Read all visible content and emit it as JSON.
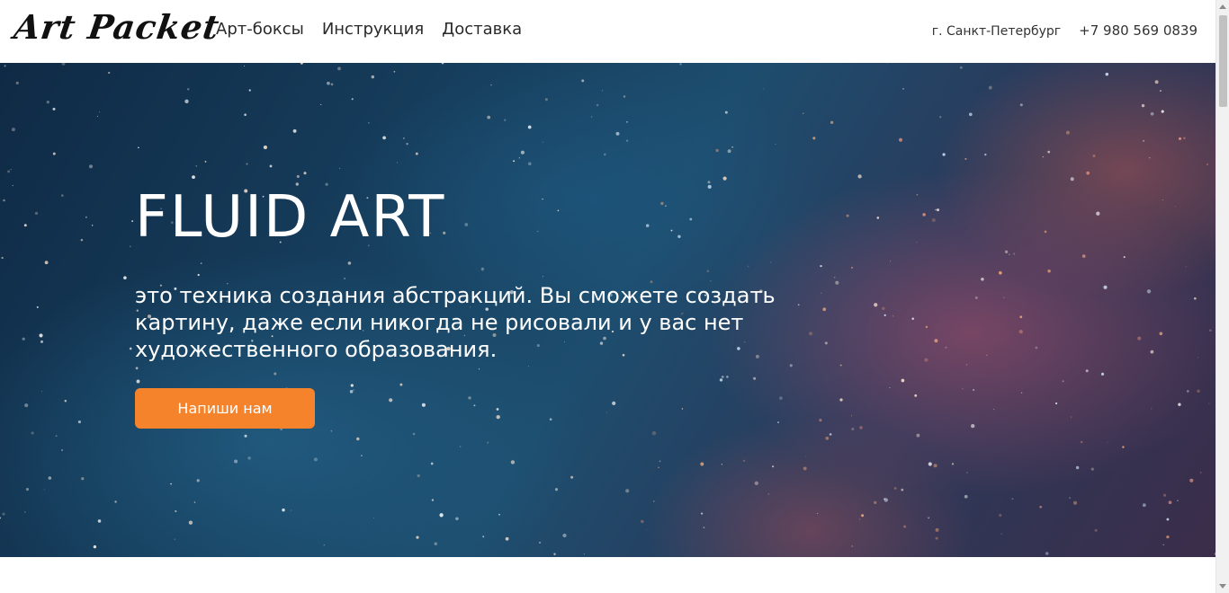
{
  "header": {
    "logo": "Art Packet",
    "nav": [
      {
        "label": "Арт-боксы"
      },
      {
        "label": "Инструкция"
      },
      {
        "label": "Доставка"
      }
    ],
    "city": "г. Санкт-Петербург",
    "phone": "+7 980 569 0839"
  },
  "hero": {
    "title": "FLUID ART",
    "text": "это техника создания абстракций. Вы сможете создать картину, даже если никогда не рисовали и у вас нет художественного образования.",
    "button_label": "Напиши нам"
  },
  "colors": {
    "accent": "#f5832b",
    "hero_base": "#163d5c"
  }
}
